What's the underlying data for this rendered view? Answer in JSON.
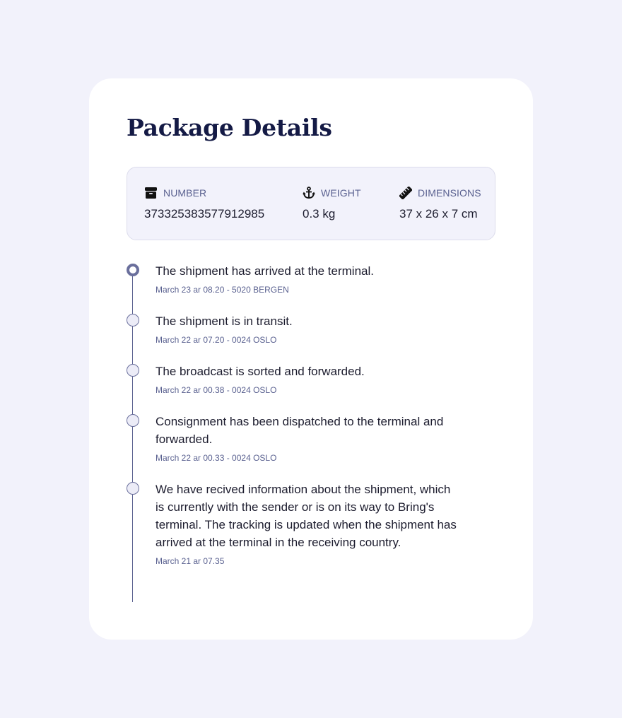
{
  "title": "Package Details",
  "info": {
    "number": {
      "label": "NUMBER",
      "value": "373325383577912985",
      "icon": "box-icon"
    },
    "weight": {
      "label": "WEIGHT",
      "value": "0.3 kg",
      "icon": "anchor-icon"
    },
    "dimensions": {
      "label": "DIMENSIONS",
      "value": "37 x 26 x 7 cm",
      "icon": "ruler-icon"
    }
  },
  "timeline": [
    {
      "text": "The shipment has arrived at the terminal.",
      "meta": "March 23 ar 08.20 - 5020 BERGEN",
      "active": true
    },
    {
      "text": "The shipment is in transit.",
      "meta": "March 22 ar 07.20 - 0024 OSLO",
      "active": false
    },
    {
      "text": "The broadcast is sorted and forwarded.",
      "meta": "March 22 ar 00.38 - 0024 OSLO",
      "active": false
    },
    {
      "text": "Consignment has been dispatched to the terminal and forwarded.",
      "meta": "March 22 ar 00.33 - 0024 OSLO",
      "active": false
    },
    {
      "text": "We have recived information about the shipment, which is currently with the sender or is on its way to Bring's terminal. The tracking is updated when the shipment has arrived at the terminal in the receiving country.",
      "meta": "March 21 ar 07.35",
      "active": false
    }
  ],
  "colors": {
    "background": "#f2f2fb",
    "card": "#ffffff",
    "title": "#141a45",
    "accent": "#5a6190"
  }
}
